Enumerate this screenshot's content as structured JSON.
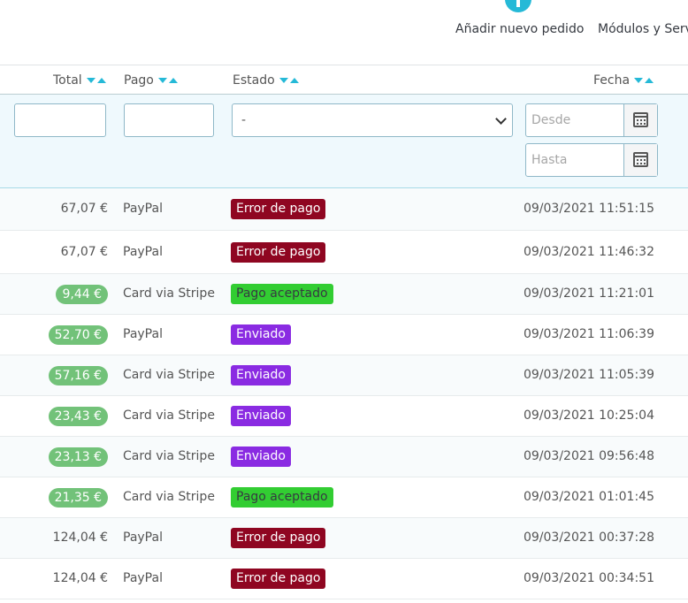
{
  "toolbar": {
    "add_order_label": "Añadir nuevo pedido",
    "modules_label": "Módulos y Serv"
  },
  "columns": {
    "total": "Total",
    "payment": "Pago",
    "status": "Estado",
    "date": "Fecha"
  },
  "filters": {
    "status_selected": "-",
    "date_from_placeholder": "Desde",
    "date_to_placeholder": "Hasta"
  },
  "rows": [
    {
      "total": "67,07 €",
      "total_highlight": false,
      "payment": "PayPal",
      "status": "Error de pago",
      "status_color": "#8f0621",
      "status_text_color": "#ffffff",
      "date": "09/03/2021 11:51:15"
    },
    {
      "total": "67,07 €",
      "total_highlight": false,
      "payment": "PayPal",
      "status": "Error de pago",
      "status_color": "#8f0621",
      "status_text_color": "#ffffff",
      "date": "09/03/2021 11:46:32"
    },
    {
      "total": "9,44 €",
      "total_highlight": true,
      "payment": "Card via Stripe",
      "status": "Pago aceptado",
      "status_color": "#32cd32",
      "status_text_color": "#363a41",
      "date": "09/03/2021 11:21:01"
    },
    {
      "total": "52,70 €",
      "total_highlight": true,
      "payment": "PayPal",
      "status": "Enviado",
      "status_color": "#8a2be2",
      "status_text_color": "#ffffff",
      "date": "09/03/2021 11:06:39"
    },
    {
      "total": "57,16 €",
      "total_highlight": true,
      "payment": "Card via Stripe",
      "status": "Enviado",
      "status_color": "#8a2be2",
      "status_text_color": "#ffffff",
      "date": "09/03/2021 11:05:39"
    },
    {
      "total": "23,43 €",
      "total_highlight": true,
      "payment": "Card via Stripe",
      "status": "Enviado",
      "status_color": "#8a2be2",
      "status_text_color": "#ffffff",
      "date": "09/03/2021 10:25:04"
    },
    {
      "total": "23,13 €",
      "total_highlight": true,
      "payment": "Card via Stripe",
      "status": "Enviado",
      "status_color": "#8a2be2",
      "status_text_color": "#ffffff",
      "date": "09/03/2021 09:56:48"
    },
    {
      "total": "21,35 €",
      "total_highlight": true,
      "payment": "Card via Stripe",
      "status": "Pago aceptado",
      "status_color": "#32cd32",
      "status_text_color": "#363a41",
      "date": "09/03/2021 01:01:45"
    },
    {
      "total": "124,04 €",
      "total_highlight": false,
      "payment": "PayPal",
      "status": "Error de pago",
      "status_color": "#8f0621",
      "status_text_color": "#ffffff",
      "date": "09/03/2021 00:37:28"
    },
    {
      "total": "124,04 €",
      "total_highlight": false,
      "payment": "PayPal",
      "status": "Error de pago",
      "status_color": "#8f0621",
      "status_text_color": "#ffffff",
      "date": "09/03/2021 00:34:51"
    }
  ],
  "colors": {
    "accent": "#25b9d7",
    "paid_pill": "#72c279"
  }
}
